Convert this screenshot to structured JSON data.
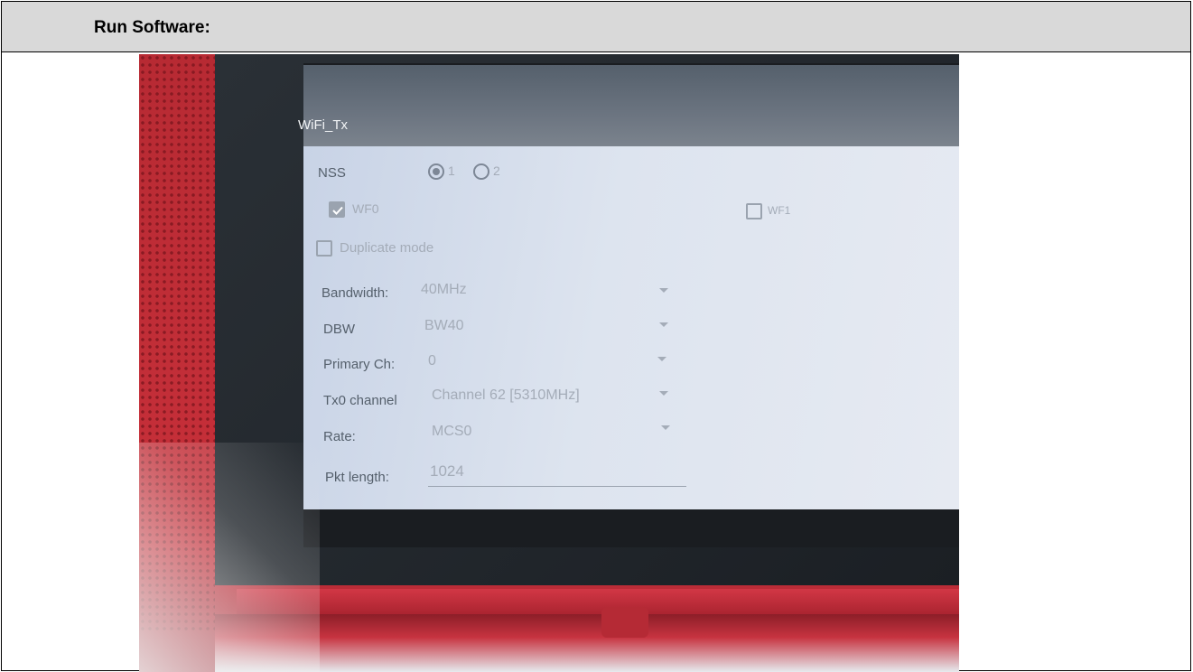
{
  "header": {
    "title": "Run Software:"
  },
  "app": {
    "title": "WiFi_Tx",
    "nss": {
      "label": "NSS",
      "options": [
        "1",
        "2"
      ],
      "selected": "1"
    },
    "wf0": {
      "label": "WF0",
      "checked": true
    },
    "wf1": {
      "label": "WF1",
      "checked": false
    },
    "duplicate": {
      "label": "Duplicate mode",
      "checked": false
    },
    "fields": [
      {
        "label": "Bandwidth:",
        "value": "40MHz"
      },
      {
        "label": "DBW",
        "value": "BW40"
      },
      {
        "label": "Primary Ch:",
        "value": "0"
      },
      {
        "label": "Tx0 channel",
        "value": "Channel 62 [5310MHz]"
      },
      {
        "label": "Rate:",
        "value": "MCS0"
      }
    ],
    "pkt_length": {
      "label": "Pkt length:",
      "value": "1024"
    }
  },
  "colors": {
    "bezel": "#c8303a",
    "panel": "#dde4ef",
    "header_band": "#d9d9d9"
  }
}
